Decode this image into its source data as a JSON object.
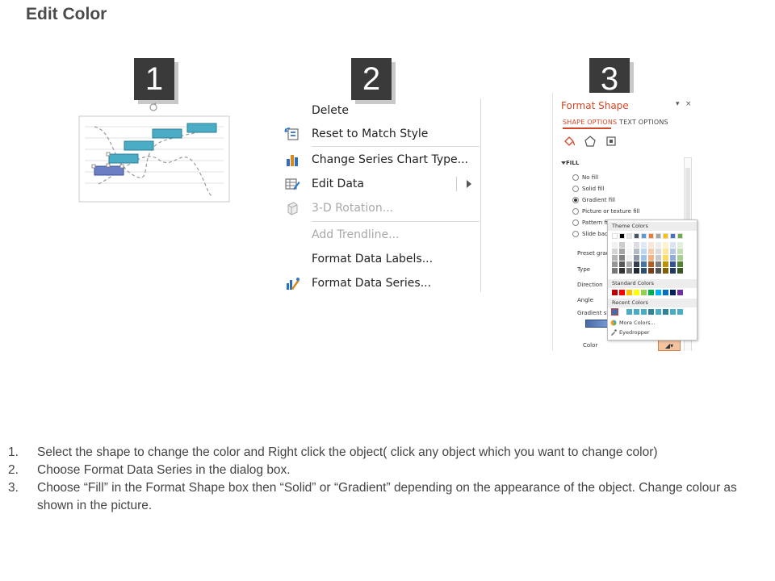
{
  "page": {
    "title": "Edit Color"
  },
  "badges": [
    "1",
    "2",
    "3"
  ],
  "context_menu": {
    "items": [
      {
        "label": "Delete",
        "icon": "none",
        "disabled": false
      },
      {
        "label": "Reset to Match Style",
        "icon": "reset-style-icon",
        "disabled": false
      },
      {
        "label": "Change Series Chart Type...",
        "icon": "bar-chart-icon",
        "disabled": false
      },
      {
        "label": "Edit Data",
        "icon": "edit-data-icon",
        "disabled": false,
        "submenu": true
      },
      {
        "label": "3-D Rotation...",
        "icon": "cube-icon",
        "disabled": true
      },
      {
        "label": "Add Trendline...",
        "icon": "none",
        "disabled": true
      },
      {
        "label": "Format Data Labels...",
        "icon": "none",
        "disabled": false
      },
      {
        "label": "Format Data Series...",
        "icon": "format-series-icon",
        "disabled": false
      }
    ]
  },
  "format_shape": {
    "title": "Format Shape",
    "controls": [
      "▾",
      "×"
    ],
    "tabs": [
      "SHAPE OPTIONS",
      "TEXT OPTIONS"
    ],
    "section": "FILL",
    "fill_options": [
      {
        "label": "No fill",
        "selected": false
      },
      {
        "label": "Solid fill",
        "selected": false
      },
      {
        "label": "Gradient fill",
        "selected": true
      },
      {
        "label": "Picture or texture fill",
        "selected": false
      },
      {
        "label": "Pattern fill",
        "selected": false
      },
      {
        "label": "Slide back",
        "selected": false
      }
    ],
    "properties": [
      "Preset grad",
      "Type",
      "Direction",
      "Angle",
      "Gradient st",
      "Color"
    ],
    "color_button": "▾"
  },
  "color_picker": {
    "theme_header": "Theme Colors",
    "standard_header": "Standard Colors",
    "recent_header": "Recent Colors",
    "more_colors": "More Colors...",
    "eyedropper": "Eyedropper",
    "theme_top": [
      "#ffffff",
      "#000000",
      "#e7e6e6",
      "#44546a",
      "#5b9bd5",
      "#ed7d31",
      "#a5a5a5",
      "#ffc000",
      "#4472c4",
      "#70ad47"
    ],
    "standard": [
      "#c00000",
      "#ff0000",
      "#ffc000",
      "#ffff00",
      "#92d050",
      "#00b050",
      "#00b0f0",
      "#0070c0",
      "#002060",
      "#7030a0"
    ],
    "recent": [
      "#4a6aa8",
      "#ffffff",
      "#4bacc6",
      "#4bacc6",
      "#4bacc6",
      "#31849b",
      "#4bacc6",
      "#31849b",
      "#4bacc6",
      "#4bacc6"
    ]
  },
  "instructions": [
    {
      "num": "1.",
      "text": "Select the shape to change the color and Right click the object( click any object which you want to change color)"
    },
    {
      "num": "2.",
      "text": "Choose Format Data Series in the dialog box."
    },
    {
      "num": "3.",
      "text": "Choose “Fill” in the Format Shape box then “Solid” or “Gradient” depending on the appearance of the object. Change colour as shown in the picture."
    }
  ],
  "colors": {
    "accent": "#d24726",
    "badge": "#3a3a3a",
    "bar_teal": "#4bacc6",
    "bar_blue": "#6d7fc4"
  }
}
